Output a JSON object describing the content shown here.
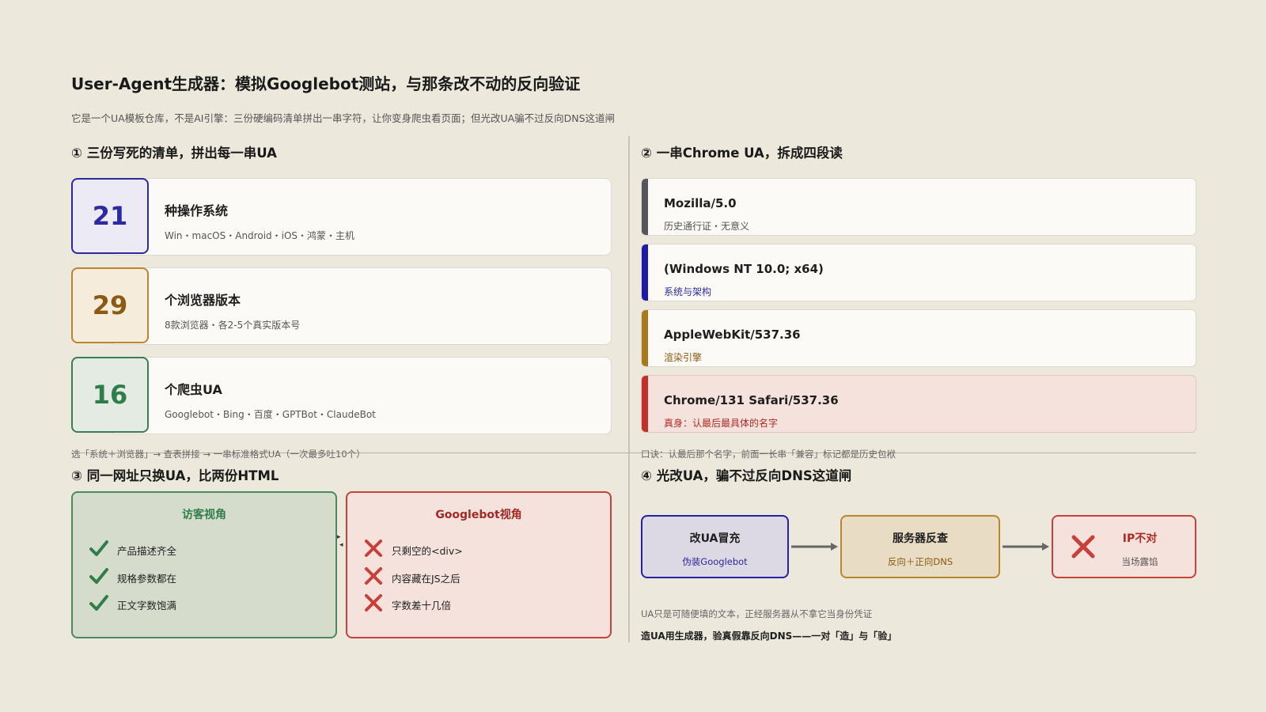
{
  "header": {
    "title": "User-Agent生成器：模拟Googlebot测站，与那条改不动的反向验证",
    "subtitle": "它是一个UA模板仓库，不是AI引擎：三份硬编码清单拼出一串字符，让你变身爬虫看页面；但光改UA骗不过反向DNS这道闸"
  },
  "section1": {
    "heading": "① 三份写死的清单，拼出每一串UA",
    "items": [
      {
        "count": "21",
        "name": "种操作系统",
        "desc": "Win・macOS・Android・iOS・鸿蒙・主机",
        "color": "#2b2aa0"
      },
      {
        "count": "29",
        "name": "个浏览器版本",
        "desc": "8款浏览器・各2-5个真实版本号",
        "color": "#8a5a12"
      },
      {
        "count": "16",
        "name": "个爬虫UA",
        "desc": "Googlebot・Bing・百度・GPTBot・ClaudeBot",
        "color": "#2e7d4a"
      }
    ],
    "note": "选「系统＋浏览器」→ 查表拼接 → 一串标准格式UA（一次最多吐10个）"
  },
  "section2": {
    "heading": "② 一串Chrome UA，拆成四段读",
    "segments": [
      {
        "code": "Mozilla/5.0",
        "desc": "历史通行证・无意义",
        "bar": "#55555c",
        "desc_color": "#555555",
        "bg": "#fbfaf6",
        "border": "#dcd8cc"
      },
      {
        "code": "(Windows NT 10.0; x64)",
        "desc": "系统与架构",
        "bar": "#1f1aa8",
        "desc_color": "#2b2aa0",
        "bg": "#fbfaf6",
        "border": "#dcd8cc"
      },
      {
        "code": "AppleWebKit/537.36",
        "desc": "渲染引擎",
        "bar": "#a8791a",
        "desc_color": "#8a5a12",
        "bg": "#fbfaf6",
        "border": "#dcd8cc"
      },
      {
        "code": "Chrome/131 Safari/537.36",
        "desc": "真身：认最后最具体的名字",
        "bar": "#c0312b",
        "desc_color": "#b02a24",
        "bg": "#f6e2dc",
        "border": "#e7c4bb"
      }
    ],
    "note": "口诀：认最后那个名字，前面一长串「兼容」标记都是历史包袱"
  },
  "section3": {
    "heading": "③ 同一网址只换UA，比两份HTML",
    "visitor": {
      "title": "访客视角",
      "items": [
        "产品描述齐全",
        "规格参数都在",
        "正文字数饱满"
      ],
      "color": "#2e7d4a"
    },
    "googlebot": {
      "title": "Googlebot视角",
      "items": [
        "只剩空的<div>",
        "内容藏在JS之后",
        "字数差十几倍"
      ],
      "color": "#a02a24"
    }
  },
  "section4": {
    "heading": "④ 光改UA，骗不过反向DNS这道闸",
    "steps": [
      {
        "title": "改UA冒充",
        "sub": "伪装Googlebot"
      },
      {
        "title": "服务器反查",
        "sub": "反向＋正向DNS"
      },
      {
        "title": "IP不对",
        "sub": "当场露馅"
      }
    ],
    "note": "UA只是可随便填的文本，正经服务器从不拿它当身份凭证",
    "summary": "造UA用生成器，验真假靠反向DNS——一对「造」与「验」"
  }
}
